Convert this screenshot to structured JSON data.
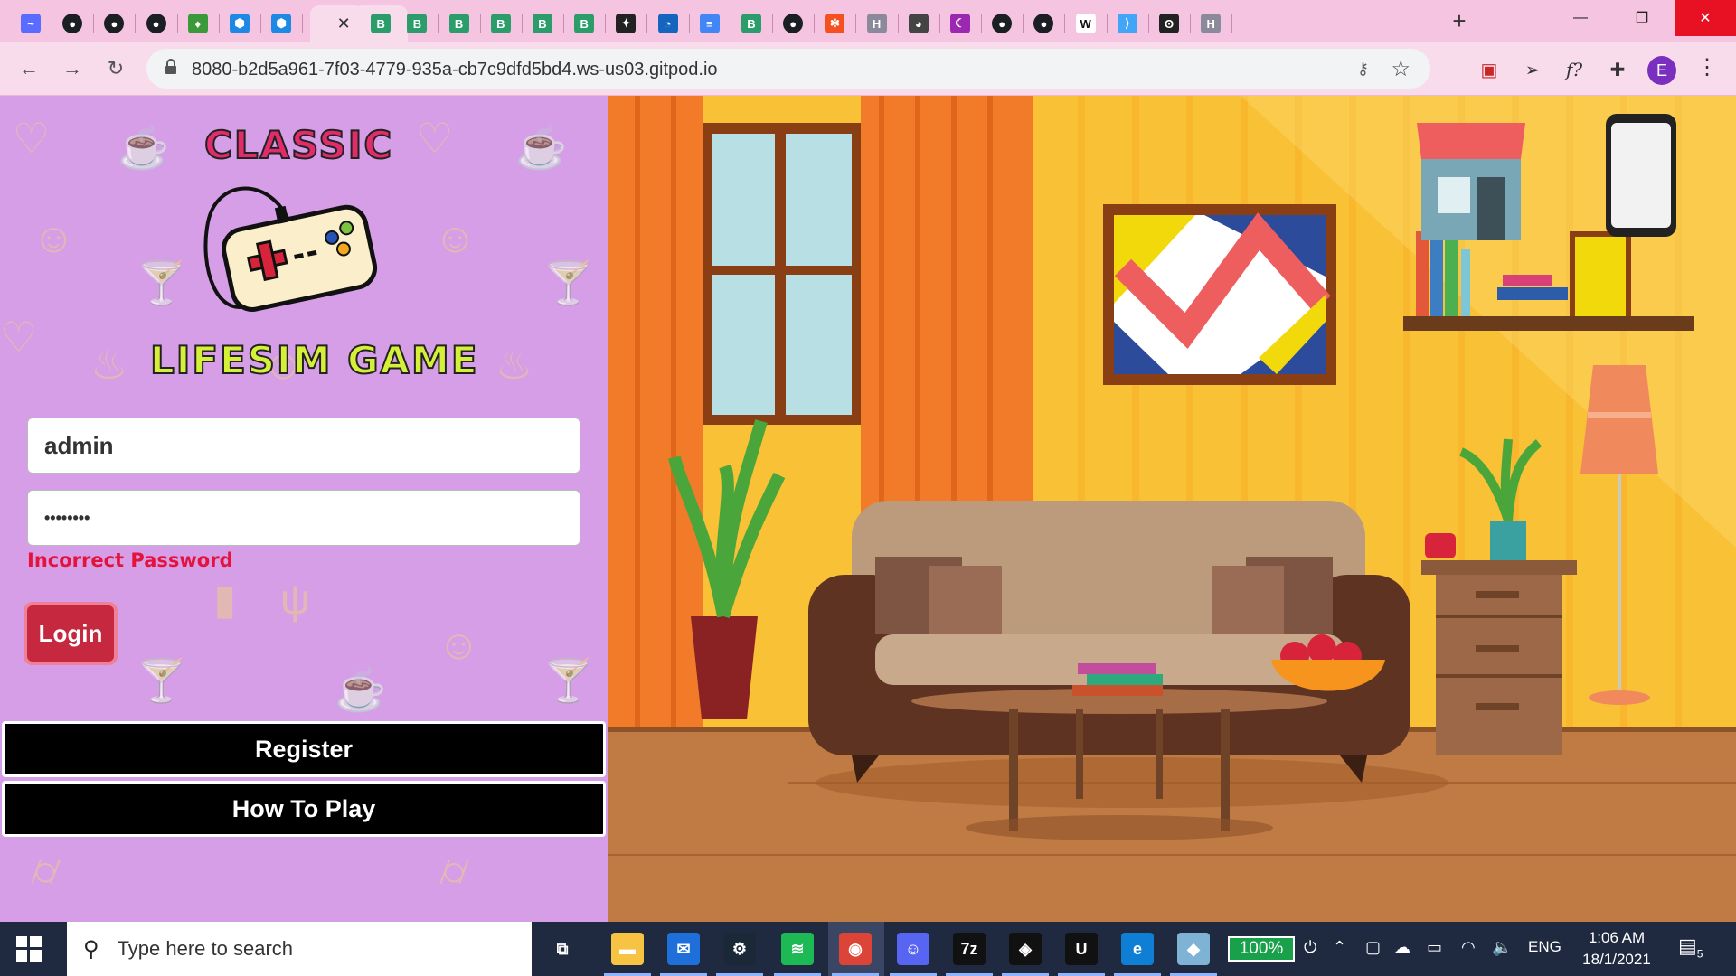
{
  "browser": {
    "url": "8080-b2d5a961-7f03-4779-935a-cb7c9dfd5bd4.ws-us03.gitpod.io",
    "tabs": [
      {
        "icon": "butterfly-icon",
        "color": "#5a6cff",
        "glyph": "~"
      },
      {
        "icon": "github-icon",
        "color": "#1b1f23",
        "glyph": "●"
      },
      {
        "icon": "github-icon",
        "color": "#1b1f23",
        "glyph": "●"
      },
      {
        "icon": "github-icon",
        "color": "#1b1f23",
        "glyph": "●"
      },
      {
        "icon": "leaf-icon",
        "color": "#3a9a3a",
        "glyph": "♦"
      },
      {
        "icon": "cube-icon",
        "color": "#1e88e5",
        "glyph": "⬢"
      },
      {
        "icon": "cube-icon",
        "color": "#1e88e5",
        "glyph": "⬢"
      },
      {
        "icon": "vue-b-icon",
        "color": "#2a9d6a",
        "glyph": "B"
      },
      {
        "icon": "vue-b-icon",
        "color": "#2a9d6a",
        "glyph": "B"
      },
      {
        "icon": "vue-b-icon",
        "color": "#2a9d6a",
        "glyph": "B"
      },
      {
        "icon": "vue-b-icon",
        "color": "#2a9d6a",
        "glyph": "B"
      },
      {
        "icon": "vue-b-icon",
        "color": "#2a9d6a",
        "glyph": "B"
      },
      {
        "icon": "vue-b-icon",
        "color": "#2a9d6a",
        "glyph": "B"
      },
      {
        "icon": "stickman-icon",
        "color": "#222222",
        "glyph": "✦"
      },
      {
        "icon": "dashboard-icon",
        "color": "#1565c0",
        "glyph": "◔"
      },
      {
        "icon": "docs-icon",
        "color": "#4285f4",
        "glyph": "≡"
      },
      {
        "icon": "vue-b-icon",
        "color": "#2a9d6a",
        "glyph": "B"
      },
      {
        "icon": "github-icon",
        "color": "#1b1f23",
        "glyph": "●"
      },
      {
        "icon": "asterisk-icon",
        "color": "#f4511e",
        "glyph": "✻"
      },
      {
        "icon": "h-icon",
        "color": "#8a8a9a",
        "glyph": "H"
      },
      {
        "icon": "globe-icon",
        "color": "#444444",
        "glyph": "◕"
      },
      {
        "icon": "moon-icon",
        "color": "#9c27b0",
        "glyph": "☾"
      },
      {
        "icon": "github-icon",
        "color": "#1b1f23",
        "glyph": "●"
      },
      {
        "icon": "github-icon",
        "color": "#1b1f23",
        "glyph": "●"
      },
      {
        "icon": "wikipedia-icon",
        "color": "#ffffff",
        "glyph": "W"
      },
      {
        "icon": "flutter-icon",
        "color": "#42a5f5",
        "glyph": "⟩"
      },
      {
        "icon": "figure-icon",
        "color": "#222222",
        "glyph": "ʘ"
      },
      {
        "icon": "h-icon",
        "color": "#8a8a9a",
        "glyph": "H"
      }
    ]
  },
  "game": {
    "logo_top": "CLASSIC",
    "logo_bottom": "LIFESIM GAME",
    "username_value": "admin",
    "password_value": "••••••••",
    "error_text": "Incorrect Password",
    "login_label": "Login",
    "register_label": "Register",
    "howto_label": "How To Play"
  },
  "taskbar": {
    "search_placeholder": "Type here to search",
    "battery_label": "100%",
    "language": "ENG",
    "time": "1:06 AM",
    "date": "18/1/2021",
    "notification_count": "5",
    "apps": [
      {
        "name": "task-view-icon",
        "glyph": "⧉",
        "color": "#1f2a40"
      },
      {
        "name": "file-explorer-icon",
        "glyph": "▬",
        "color": "#f6c343"
      },
      {
        "name": "mail-icon",
        "glyph": "✉",
        "color": "#1e6fd9"
      },
      {
        "name": "steam-icon",
        "glyph": "⚙",
        "color": "#1b2838"
      },
      {
        "name": "spotify-icon",
        "glyph": "≋",
        "color": "#1db954"
      },
      {
        "name": "chrome-icon",
        "glyph": "◉",
        "color": "#db4437"
      },
      {
        "name": "discord-icon",
        "glyph": "☺",
        "color": "#5865f2"
      },
      {
        "name": "7zip-icon",
        "glyph": "7z",
        "color": "#111111"
      },
      {
        "name": "unity-icon",
        "glyph": "◈",
        "color": "#111111"
      },
      {
        "name": "unreal-icon",
        "glyph": "U",
        "color": "#111111"
      },
      {
        "name": "edge-icon",
        "glyph": "e",
        "color": "#0f7fd6"
      },
      {
        "name": "paper-app-icon",
        "glyph": "◆",
        "color": "#7fb3d5"
      }
    ]
  }
}
